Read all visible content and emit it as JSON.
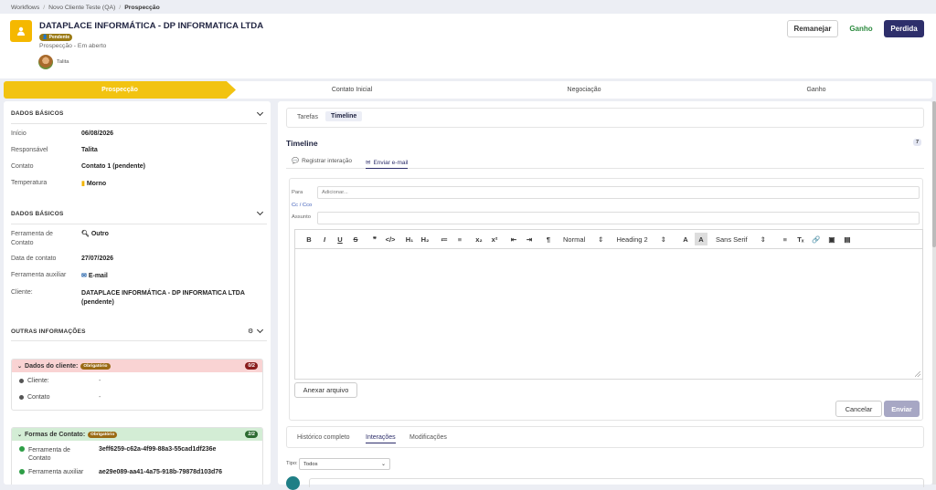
{
  "breadcrumb": {
    "items": [
      "Workflows",
      "Novo Cliente Teste (QA)"
    ],
    "current": "Prospecção"
  },
  "header": {
    "title": "DATAPLACE INFORMÁTICA - DP INFORMATICA LTDA",
    "status_badge": "Pendente",
    "subtitle": "Prospecção - Em aberto",
    "user": "Talita",
    "buttons": {
      "remanejar": "Remanejar",
      "ganho": "Ganho",
      "perdida": "Perdida"
    }
  },
  "stages": [
    {
      "label": "Prospecção",
      "active": true
    },
    {
      "label": "Contato Inicial",
      "active": false
    },
    {
      "label": "Negociação",
      "active": false
    },
    {
      "label": "Ganho",
      "active": false
    }
  ],
  "left": {
    "sec1": {
      "title": "DADOS BÁSICOS",
      "rows": [
        {
          "label": "Início",
          "value": "06/08/2026"
        },
        {
          "label": "Responsável",
          "value": "Talita"
        },
        {
          "label": "Contato",
          "value": "Contato 1 (pendente)"
        },
        {
          "label": "Temperatura",
          "value": "Morno"
        }
      ]
    },
    "sec2": {
      "title": "DADOS BÁSICOS",
      "rows": [
        {
          "label": "Ferramenta de Contato",
          "value": "Outro"
        },
        {
          "label": "Data de contato",
          "value": "27/07/2026"
        },
        {
          "label": "Ferramenta auxiliar",
          "value": "E-mail"
        },
        {
          "label": "Cliente:",
          "value": "DATAPLACE INFORMÁTICA - DP INFORMATICA LTDA (pendente)"
        }
      ]
    },
    "sec3": {
      "title": "OUTRAS INFORMAÇÕES"
    },
    "group1": {
      "title": "Dados do cliente:",
      "badge": "Obrigatório",
      "count": "0/2",
      "rows": [
        {
          "label": "Cliente:",
          "value": "-"
        },
        {
          "label": "Contato",
          "value": "-"
        }
      ]
    },
    "group2": {
      "title": "Formas de Contato:",
      "badge": "Obrigatório",
      "count": "2/2",
      "rows": [
        {
          "label": "Ferramenta de Contato",
          "value": "3eff6259-c62a-4f99-88a3-55cad1df236e"
        },
        {
          "label": "Ferramenta auxiliar",
          "value": "ae29e089-aa41-4a75-918b-79878d103d76"
        }
      ]
    }
  },
  "right": {
    "tabs": [
      "Tarefas",
      "Timeline"
    ],
    "timeline": {
      "title": "Timeline",
      "count": "7"
    },
    "subtabs": [
      "Registrar interação",
      "Enviar e-mail"
    ],
    "email": {
      "para_label": "Para",
      "para_placeholder": "Adicionar...",
      "cc_label": "Cc / Cco",
      "assunto_label": "Assunto",
      "toolbar": {
        "normal": "Normal",
        "heading": "Heading 2",
        "font": "Sans Serif"
      },
      "anexar": "Anexar arquivo",
      "cancelar": "Cancelar",
      "enviar": "Enviar"
    },
    "history_tabs": [
      "Histórico completo",
      "Interações",
      "Modificações"
    ],
    "tipo": {
      "label": "Tipo:",
      "value": "Todos"
    }
  },
  "colors": {
    "accent": "#2e2f6b",
    "stage_active": "#f2c311",
    "green": "#2b8a3e"
  }
}
